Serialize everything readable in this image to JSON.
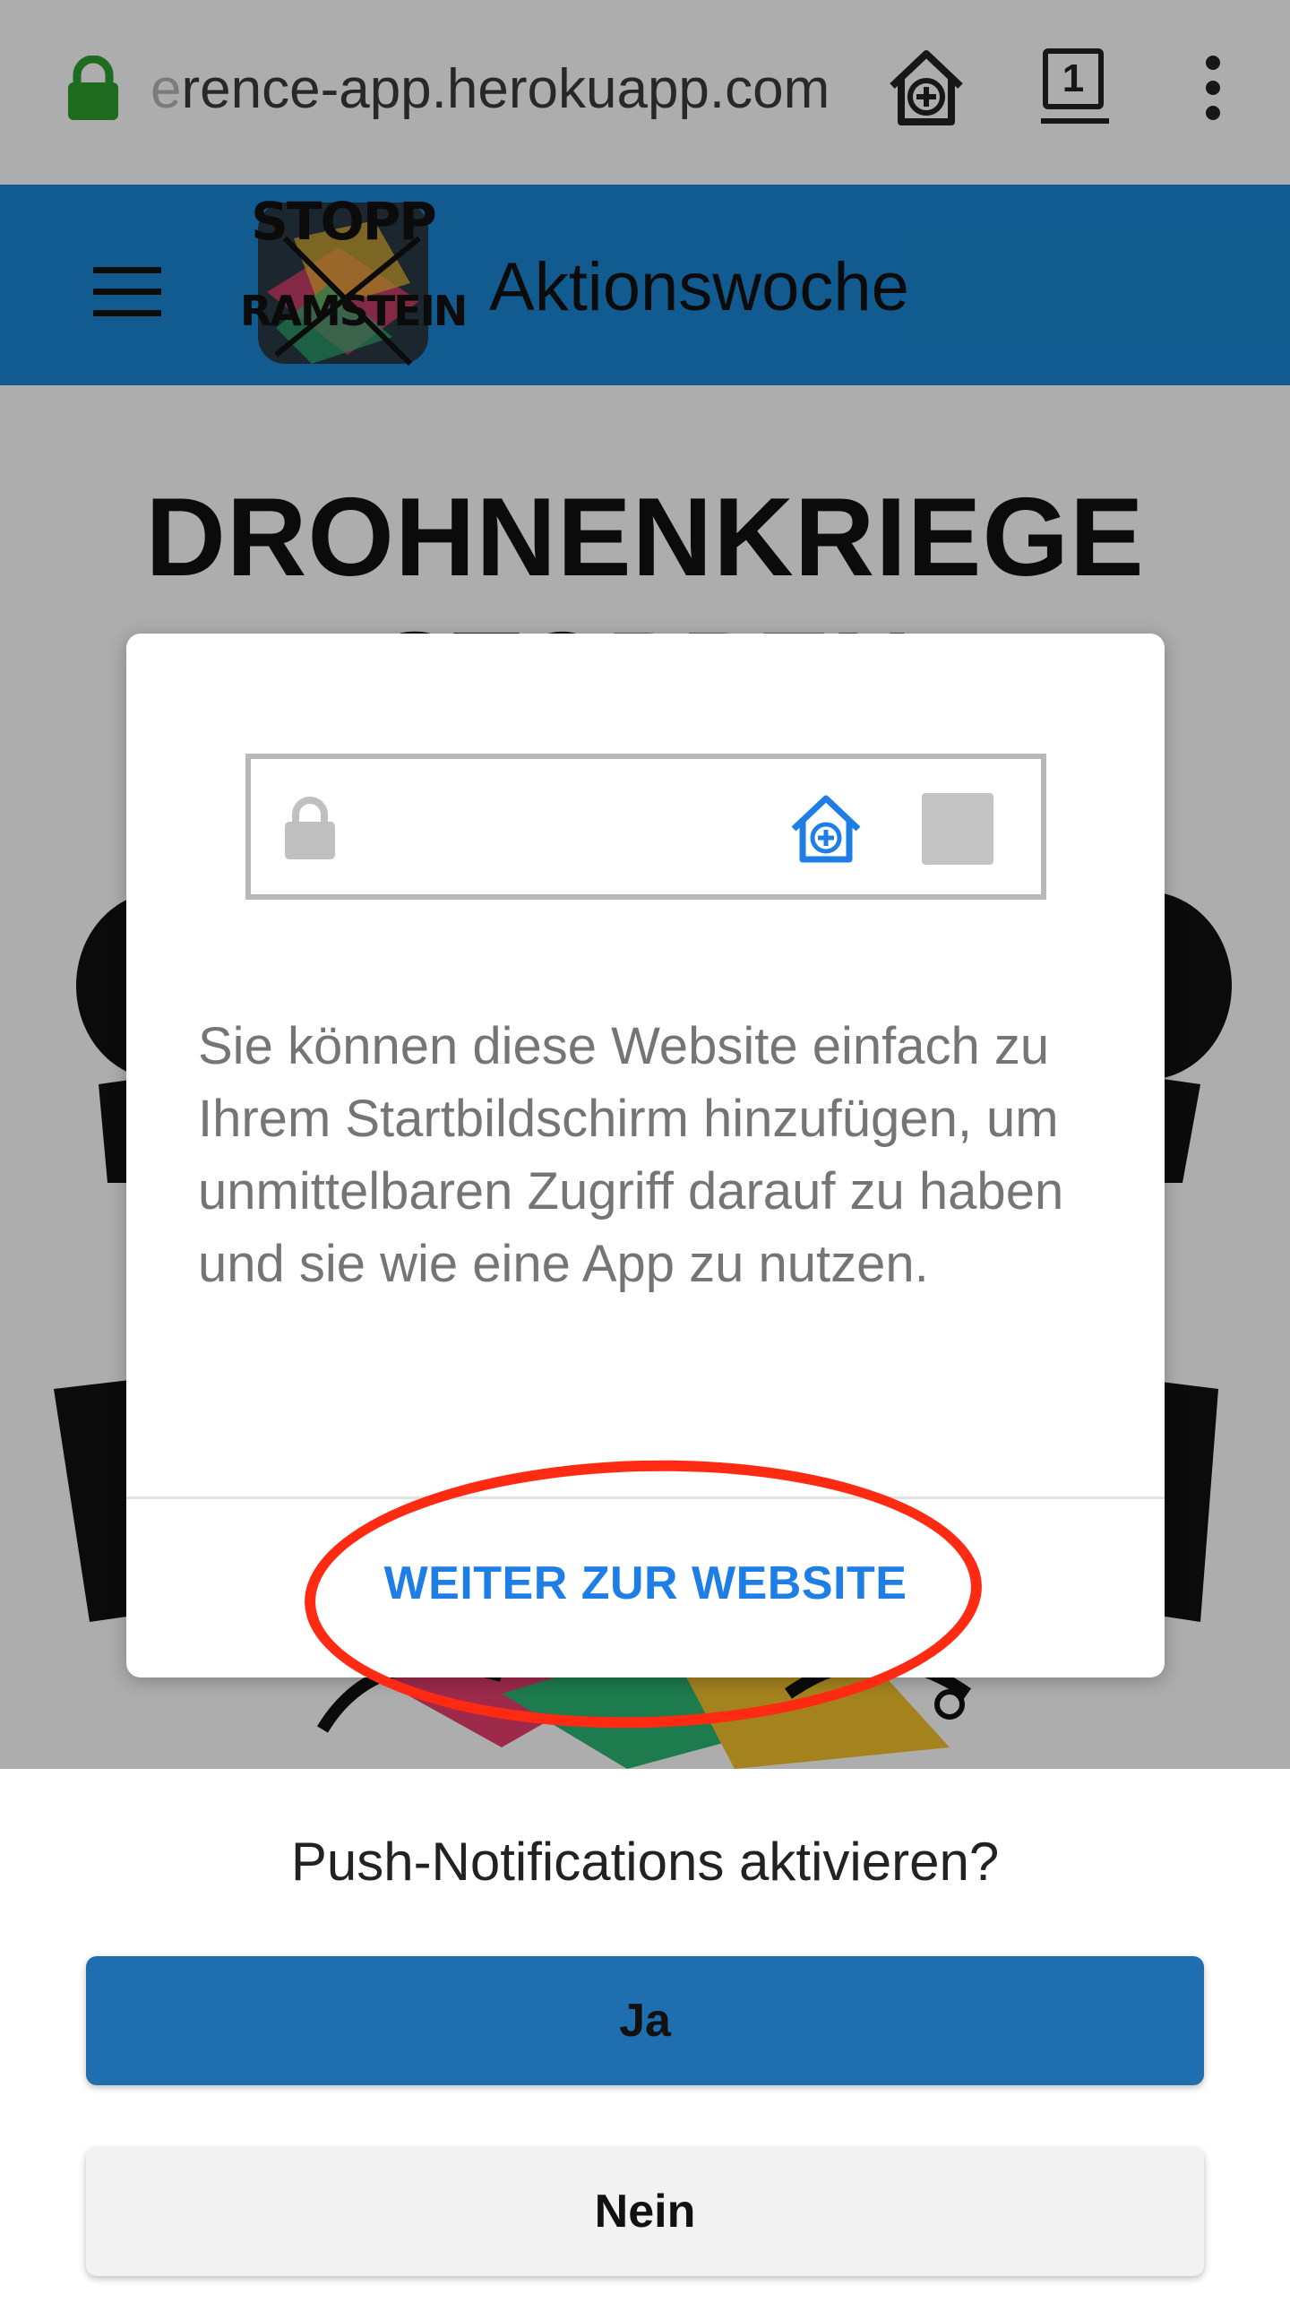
{
  "browser": {
    "url_faded": "e",
    "url_visible": "rence-app.herokuapp.com",
    "tab_count": "1",
    "icons": [
      "lock-icon",
      "add-to-home-icon",
      "tabs-icon",
      "overflow-menu-icon"
    ]
  },
  "header": {
    "title": "Aktionswoche",
    "logo_top": "STOPP",
    "logo_bottom": "RAMSTEIN",
    "color": "#1b87d4"
  },
  "page": {
    "headline": "DROHNENKRIEGE",
    "headline_partial": "STOPPEN"
  },
  "modal": {
    "text": "Sie können diese Website einfach zu Ihrem Startbildschirm hinzufügen, um unmittelbaren Zugriff darauf zu haben und sie wie eine App zu nutzen.",
    "action_label": "WEITER ZUR WEBSITE",
    "accent": "#1e7ee6"
  },
  "push": {
    "title": "Push-Notifications aktivieren?",
    "yes_label": "Ja",
    "no_label": "Nein"
  },
  "annotation": {
    "color": "#ff2a12"
  }
}
